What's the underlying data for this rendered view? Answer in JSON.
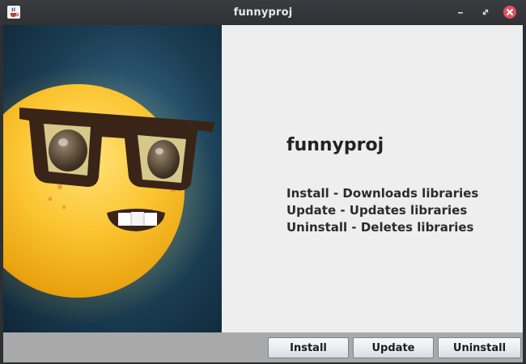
{
  "window": {
    "title": "funnyproj",
    "icons": {
      "app": "java-cup-icon",
      "minimize": "minimize-icon",
      "maximize": "maximize-icon",
      "close": "close-icon"
    }
  },
  "main": {
    "image": "nerd-face-emoji-image",
    "heading": "funnyproj",
    "lines": [
      "Install - Downloads libraries",
      "Update - Updates libraries",
      "Uninstall - Deletes libraries"
    ]
  },
  "buttons": {
    "install": "Install",
    "update": "Update",
    "uninstall": "Uninstall"
  },
  "colors": {
    "titlebar": "#2f3135",
    "close_button": "#e0505f",
    "panel_background": "#eeeeee",
    "button_bar": "#a9a9a9"
  }
}
